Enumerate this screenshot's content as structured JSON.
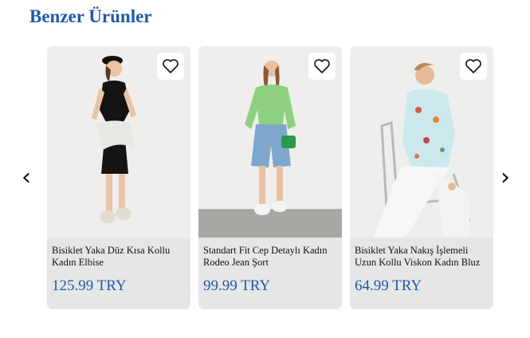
{
  "section": {
    "title": "Benzer Ürünler"
  },
  "carousel": {
    "prev_icon": "‹",
    "next_icon": "›"
  },
  "products": [
    {
      "name": "Bisiklet Yaka Düz Kısa Kollu Kadın Elbise",
      "price": "125.99 TRY"
    },
    {
      "name": "Standart Fit Cep Detaylı Kadın Rodeo Jean Şort",
      "price": "99.99 TRY"
    },
    {
      "name": "Bisiklet Yaka Nakış İşlemeli Uzun Kollu Viskon Kadın Bluz",
      "price": "64.99 TRY"
    }
  ],
  "colors": {
    "accent": "#1f5aa8",
    "card_bg": "#e6e6e6"
  }
}
